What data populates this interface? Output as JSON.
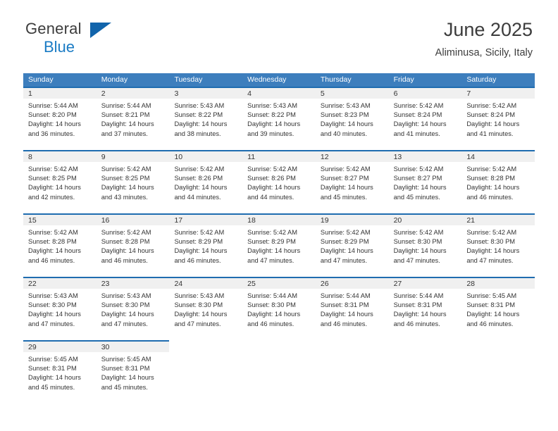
{
  "logo": {
    "word1": "General",
    "word2": "Blue",
    "triangle_color": "#1164ab",
    "blue_color": "#1a7bc4"
  },
  "header": {
    "title": "June 2025",
    "location": "Aliminusa, Sicily, Italy"
  },
  "theme": {
    "weekday_header_bg": "#3d7ebd",
    "day_number_bg": "#f0f0f0",
    "day_top_border": "#1f6cb0",
    "text": "#333333"
  },
  "weekdays": [
    "Sunday",
    "Monday",
    "Tuesday",
    "Wednesday",
    "Thursday",
    "Friday",
    "Saturday"
  ],
  "weeks": [
    [
      {
        "day": "1",
        "sunrise": "Sunrise: 5:44 AM",
        "sunset": "Sunset: 8:20 PM",
        "daylight1": "Daylight: 14 hours",
        "daylight2": "and 36 minutes."
      },
      {
        "day": "2",
        "sunrise": "Sunrise: 5:44 AM",
        "sunset": "Sunset: 8:21 PM",
        "daylight1": "Daylight: 14 hours",
        "daylight2": "and 37 minutes."
      },
      {
        "day": "3",
        "sunrise": "Sunrise: 5:43 AM",
        "sunset": "Sunset: 8:22 PM",
        "daylight1": "Daylight: 14 hours",
        "daylight2": "and 38 minutes."
      },
      {
        "day": "4",
        "sunrise": "Sunrise: 5:43 AM",
        "sunset": "Sunset: 8:22 PM",
        "daylight1": "Daylight: 14 hours",
        "daylight2": "and 39 minutes."
      },
      {
        "day": "5",
        "sunrise": "Sunrise: 5:43 AM",
        "sunset": "Sunset: 8:23 PM",
        "daylight1": "Daylight: 14 hours",
        "daylight2": "and 40 minutes."
      },
      {
        "day": "6",
        "sunrise": "Sunrise: 5:42 AM",
        "sunset": "Sunset: 8:24 PM",
        "daylight1": "Daylight: 14 hours",
        "daylight2": "and 41 minutes."
      },
      {
        "day": "7",
        "sunrise": "Sunrise: 5:42 AM",
        "sunset": "Sunset: 8:24 PM",
        "daylight1": "Daylight: 14 hours",
        "daylight2": "and 41 minutes."
      }
    ],
    [
      {
        "day": "8",
        "sunrise": "Sunrise: 5:42 AM",
        "sunset": "Sunset: 8:25 PM",
        "daylight1": "Daylight: 14 hours",
        "daylight2": "and 42 minutes."
      },
      {
        "day": "9",
        "sunrise": "Sunrise: 5:42 AM",
        "sunset": "Sunset: 8:25 PM",
        "daylight1": "Daylight: 14 hours",
        "daylight2": "and 43 minutes."
      },
      {
        "day": "10",
        "sunrise": "Sunrise: 5:42 AM",
        "sunset": "Sunset: 8:26 PM",
        "daylight1": "Daylight: 14 hours",
        "daylight2": "and 44 minutes."
      },
      {
        "day": "11",
        "sunrise": "Sunrise: 5:42 AM",
        "sunset": "Sunset: 8:26 PM",
        "daylight1": "Daylight: 14 hours",
        "daylight2": "and 44 minutes."
      },
      {
        "day": "12",
        "sunrise": "Sunrise: 5:42 AM",
        "sunset": "Sunset: 8:27 PM",
        "daylight1": "Daylight: 14 hours",
        "daylight2": "and 45 minutes."
      },
      {
        "day": "13",
        "sunrise": "Sunrise: 5:42 AM",
        "sunset": "Sunset: 8:27 PM",
        "daylight1": "Daylight: 14 hours",
        "daylight2": "and 45 minutes."
      },
      {
        "day": "14",
        "sunrise": "Sunrise: 5:42 AM",
        "sunset": "Sunset: 8:28 PM",
        "daylight1": "Daylight: 14 hours",
        "daylight2": "and 46 minutes."
      }
    ],
    [
      {
        "day": "15",
        "sunrise": "Sunrise: 5:42 AM",
        "sunset": "Sunset: 8:28 PM",
        "daylight1": "Daylight: 14 hours",
        "daylight2": "and 46 minutes."
      },
      {
        "day": "16",
        "sunrise": "Sunrise: 5:42 AM",
        "sunset": "Sunset: 8:28 PM",
        "daylight1": "Daylight: 14 hours",
        "daylight2": "and 46 minutes."
      },
      {
        "day": "17",
        "sunrise": "Sunrise: 5:42 AM",
        "sunset": "Sunset: 8:29 PM",
        "daylight1": "Daylight: 14 hours",
        "daylight2": "and 46 minutes."
      },
      {
        "day": "18",
        "sunrise": "Sunrise: 5:42 AM",
        "sunset": "Sunset: 8:29 PM",
        "daylight1": "Daylight: 14 hours",
        "daylight2": "and 47 minutes."
      },
      {
        "day": "19",
        "sunrise": "Sunrise: 5:42 AM",
        "sunset": "Sunset: 8:29 PM",
        "daylight1": "Daylight: 14 hours",
        "daylight2": "and 47 minutes."
      },
      {
        "day": "20",
        "sunrise": "Sunrise: 5:42 AM",
        "sunset": "Sunset: 8:30 PM",
        "daylight1": "Daylight: 14 hours",
        "daylight2": "and 47 minutes."
      },
      {
        "day": "21",
        "sunrise": "Sunrise: 5:42 AM",
        "sunset": "Sunset: 8:30 PM",
        "daylight1": "Daylight: 14 hours",
        "daylight2": "and 47 minutes."
      }
    ],
    [
      {
        "day": "22",
        "sunrise": "Sunrise: 5:43 AM",
        "sunset": "Sunset: 8:30 PM",
        "daylight1": "Daylight: 14 hours",
        "daylight2": "and 47 minutes."
      },
      {
        "day": "23",
        "sunrise": "Sunrise: 5:43 AM",
        "sunset": "Sunset: 8:30 PM",
        "daylight1": "Daylight: 14 hours",
        "daylight2": "and 47 minutes."
      },
      {
        "day": "24",
        "sunrise": "Sunrise: 5:43 AM",
        "sunset": "Sunset: 8:30 PM",
        "daylight1": "Daylight: 14 hours",
        "daylight2": "and 47 minutes."
      },
      {
        "day": "25",
        "sunrise": "Sunrise: 5:44 AM",
        "sunset": "Sunset: 8:30 PM",
        "daylight1": "Daylight: 14 hours",
        "daylight2": "and 46 minutes."
      },
      {
        "day": "26",
        "sunrise": "Sunrise: 5:44 AM",
        "sunset": "Sunset: 8:31 PM",
        "daylight1": "Daylight: 14 hours",
        "daylight2": "and 46 minutes."
      },
      {
        "day": "27",
        "sunrise": "Sunrise: 5:44 AM",
        "sunset": "Sunset: 8:31 PM",
        "daylight1": "Daylight: 14 hours",
        "daylight2": "and 46 minutes."
      },
      {
        "day": "28",
        "sunrise": "Sunrise: 5:45 AM",
        "sunset": "Sunset: 8:31 PM",
        "daylight1": "Daylight: 14 hours",
        "daylight2": "and 46 minutes."
      }
    ],
    [
      {
        "day": "29",
        "sunrise": "Sunrise: 5:45 AM",
        "sunset": "Sunset: 8:31 PM",
        "daylight1": "Daylight: 14 hours",
        "daylight2": "and 45 minutes."
      },
      {
        "day": "30",
        "sunrise": "Sunrise: 5:45 AM",
        "sunset": "Sunset: 8:31 PM",
        "daylight1": "Daylight: 14 hours",
        "daylight2": "and 45 minutes."
      },
      {
        "day": "",
        "sunrise": "",
        "sunset": "",
        "daylight1": "",
        "daylight2": ""
      },
      {
        "day": "",
        "sunrise": "",
        "sunset": "",
        "daylight1": "",
        "daylight2": ""
      },
      {
        "day": "",
        "sunrise": "",
        "sunset": "",
        "daylight1": "",
        "daylight2": ""
      },
      {
        "day": "",
        "sunrise": "",
        "sunset": "",
        "daylight1": "",
        "daylight2": ""
      },
      {
        "day": "",
        "sunrise": "",
        "sunset": "",
        "daylight1": "",
        "daylight2": ""
      }
    ]
  ]
}
